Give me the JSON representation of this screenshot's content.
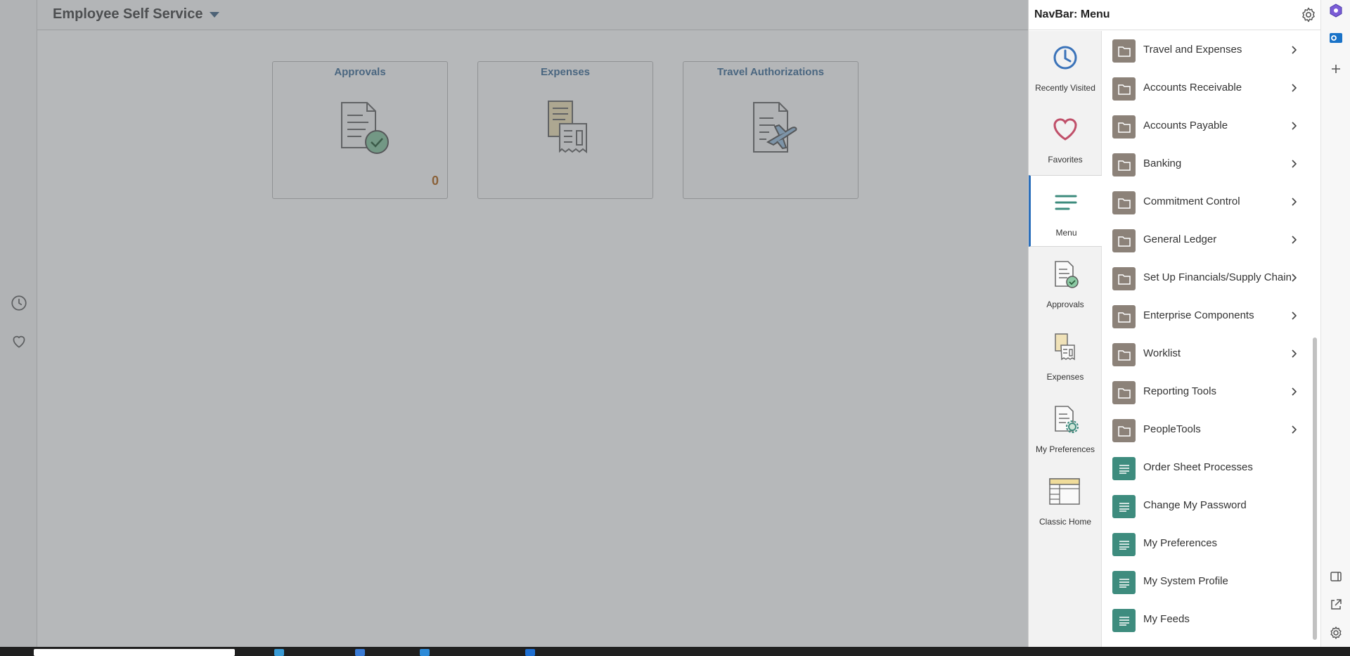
{
  "page": {
    "header_title": "Employee Self Service",
    "tiles": [
      {
        "title": "Approvals",
        "icon": "approvals-document-check-icon",
        "count": "0"
      },
      {
        "title": "Expenses",
        "icon": "expenses-receipts-icon"
      },
      {
        "title": "Travel Authorizations",
        "icon": "travel-document-plane-icon"
      }
    ]
  },
  "navbar": {
    "title": "NavBar: Menu",
    "tabs": [
      {
        "label": "Recently Visited",
        "icon": "clock-icon"
      },
      {
        "label": "Favorites",
        "icon": "heart-icon"
      },
      {
        "label": "Menu",
        "icon": "hamburger-menu-icon",
        "active": true
      },
      {
        "label": "Approvals",
        "icon": "approvals-icon"
      },
      {
        "label": "Expenses",
        "icon": "expenses-icon"
      },
      {
        "label": "My Preferences",
        "icon": "preferences-gear-icon"
      },
      {
        "label": "Classic Home",
        "icon": "classic-home-icon"
      }
    ],
    "menu_items": [
      {
        "label": "Travel and Expenses",
        "type": "folder"
      },
      {
        "label": "Accounts Receivable",
        "type": "folder"
      },
      {
        "label": "Accounts Payable",
        "type": "folder"
      },
      {
        "label": "Banking",
        "type": "folder"
      },
      {
        "label": "Commitment Control",
        "type": "folder"
      },
      {
        "label": "General Ledger",
        "type": "folder"
      },
      {
        "label": "Set Up Financials/Supply Chain",
        "type": "folder"
      },
      {
        "label": "Enterprise Components",
        "type": "folder"
      },
      {
        "label": "Worklist",
        "type": "folder"
      },
      {
        "label": "Reporting Tools",
        "type": "folder"
      },
      {
        "label": "PeopleTools",
        "type": "folder"
      },
      {
        "label": "Order Sheet Processes",
        "type": "page"
      },
      {
        "label": "Change My Password",
        "type": "page"
      },
      {
        "label": "My Preferences",
        "type": "page"
      },
      {
        "label": "My System Profile",
        "type": "page"
      },
      {
        "label": "My Feeds",
        "type": "page"
      }
    ]
  },
  "colors": {
    "folder_icon_bg": "#8c8279",
    "page_icon_bg": "#3e8c7e",
    "active_tab_accent": "#2a6ebb",
    "tile_title": "#46739b",
    "tile_count": "#b46a21"
  }
}
